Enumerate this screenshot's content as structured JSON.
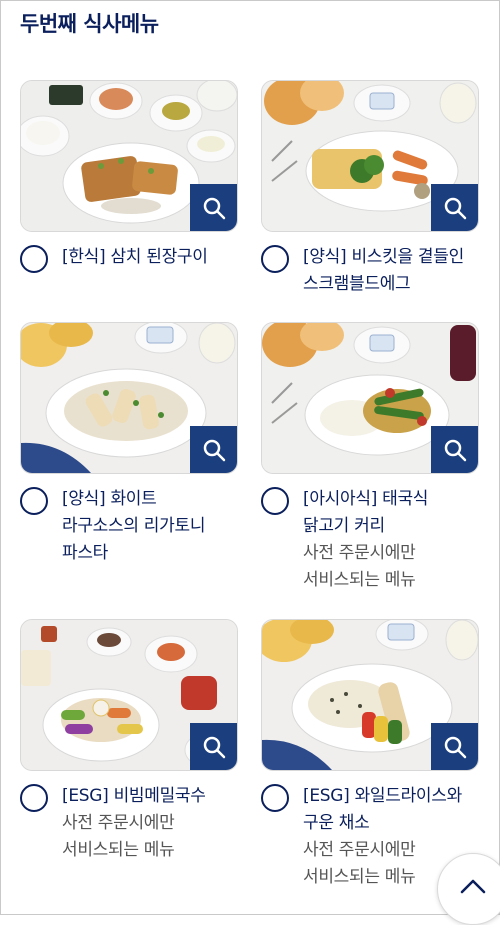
{
  "section_title": "두번째 식사메뉴",
  "meals": [
    {
      "name_line1": "[한식] 삼치 된장구이",
      "name_line2": "",
      "name_line3": "",
      "note_line1": "",
      "note_line2": "",
      "image": "korean-grilled-mackerel-meal-photo"
    },
    {
      "name_line1": "[양식] 비스킷을 곁들인",
      "name_line2": "스크램블드에그",
      "name_line3": "",
      "note_line1": "",
      "note_line2": "",
      "image": "scrambled-egg-biscuit-meal-photo"
    },
    {
      "name_line1": "[양식] 화이트",
      "name_line2": "라구소스의 리가토니",
      "name_line3": "파스타",
      "note_line1": "",
      "note_line2": "",
      "image": "rigatoni-pasta-meal-photo"
    },
    {
      "name_line1": "[아시아식] 태국식",
      "name_line2": "닭고기 커리",
      "name_line3": "",
      "note_line1": "사전 주문시에만",
      "note_line2": "서비스되는 메뉴",
      "image": "thai-chicken-curry-meal-photo"
    },
    {
      "name_line1": "[ESG] 비빔메밀국수",
      "name_line2": "",
      "name_line3": "",
      "note_line1": "사전 주문시에만",
      "note_line2": "서비스되는 메뉴",
      "image": "bibim-buckwheat-noodle-meal-photo"
    },
    {
      "name_line1": "[ESG] 와일드라이스와",
      "name_line2": "구운 채소",
      "name_line3": "",
      "note_line1": "사전 주문시에만",
      "note_line2": "서비스되는 메뉴",
      "image": "wild-rice-roasted-vegetable-meal-photo"
    }
  ],
  "icons": {
    "zoom": "magnifier-icon",
    "scroll_top": "chevron-up-icon"
  },
  "colors": {
    "brand_navy": "#0a1f5c",
    "zoom_button": "#1a3e7e",
    "note_text": "#555555"
  }
}
